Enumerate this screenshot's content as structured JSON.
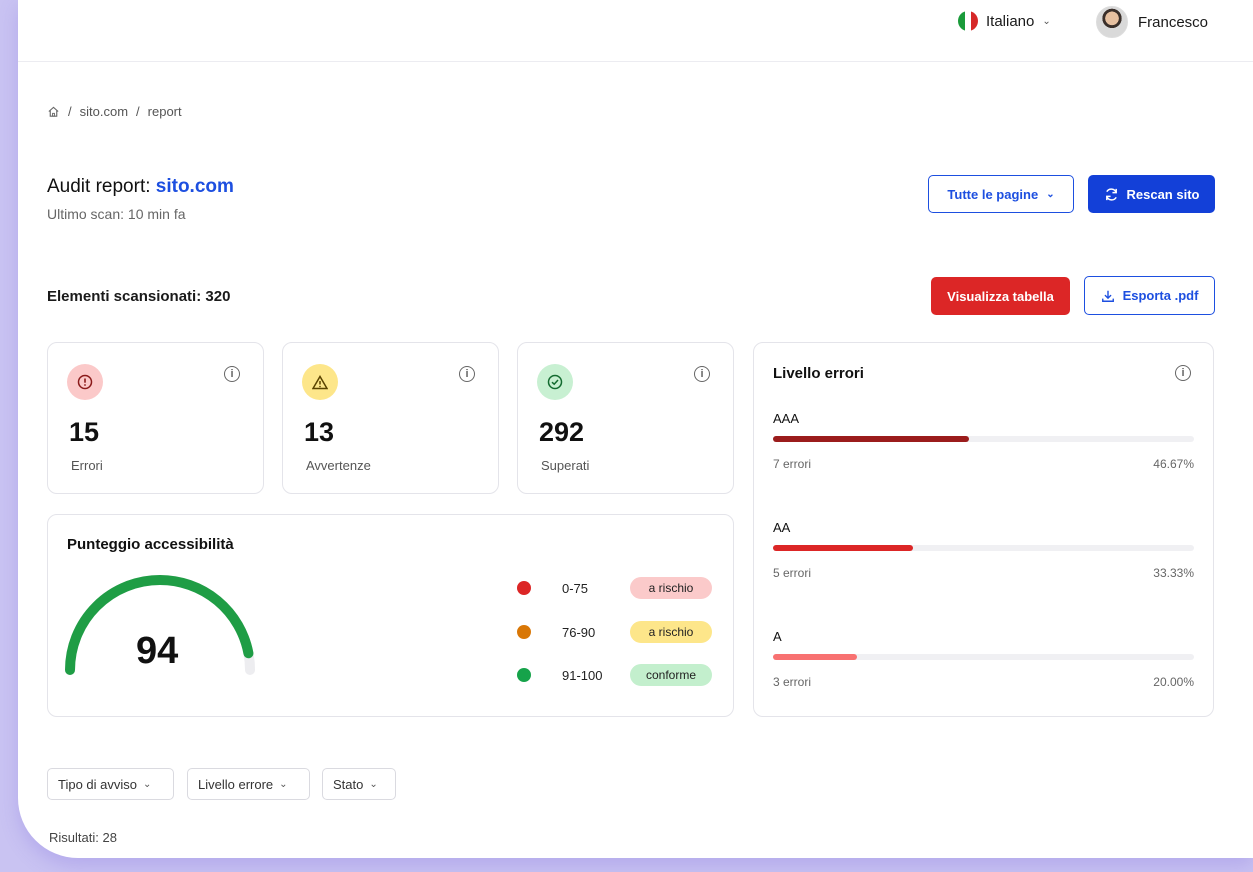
{
  "header": {
    "language": "Italiano",
    "user": "Francesco"
  },
  "breadcrumb": [
    "sito.com",
    "report"
  ],
  "report": {
    "title_prefix": "Audit report:",
    "site": "sito.com",
    "last_scan": "Ultimo scan: 10 min fa"
  },
  "actions": {
    "pages_dropdown": "Tutte le pagine",
    "rescan": "Rescan sito",
    "view_table": "Visualizza tabella",
    "export": "Esporta .pdf"
  },
  "scanned": "Elementi scansionati: 320",
  "stats": [
    {
      "value": "15",
      "label": "Errori",
      "color": "#fbc9c9",
      "icon_color": "#8b1a1a"
    },
    {
      "value": "13",
      "label": "Avvertenze",
      "color": "#fde68a",
      "icon_color": "#5a4300"
    },
    {
      "value": "292",
      "label": "Superati",
      "color": "#c8f0d2",
      "icon_color": "#136b30"
    }
  ],
  "score": {
    "title": "Punteggio accessibilità",
    "value": "94",
    "percent": 94,
    "color": "#1f9d45",
    "legend": [
      {
        "range": "0-75",
        "status": "a rischio",
        "dot": "#dc2626",
        "pill": "#fbcaca"
      },
      {
        "range": "76-90",
        "status": "a rischio",
        "dot": "#d97706",
        "pill": "#fde68a"
      },
      {
        "range": "91-100",
        "status": "conforme",
        "dot": "#16a34a",
        "pill": "#c3efcd"
      }
    ]
  },
  "levels": {
    "title": "Livello errori",
    "items": [
      {
        "name": "AAA",
        "count": "7 errori",
        "pct": "46.67%",
        "fraction": 0.4667,
        "color": "#9b1c1c"
      },
      {
        "name": "AA",
        "count": "5 errori",
        "pct": "33.33%",
        "fraction": 0.3333,
        "color": "#dc2626"
      },
      {
        "name": "A",
        "count": "3 errori",
        "pct": "20.00%",
        "fraction": 0.2,
        "color": "#f87171"
      }
    ]
  },
  "filters": [
    "Tipo di avviso",
    "Livello errore",
    "Stato"
  ],
  "results": "Risultati: 28"
}
